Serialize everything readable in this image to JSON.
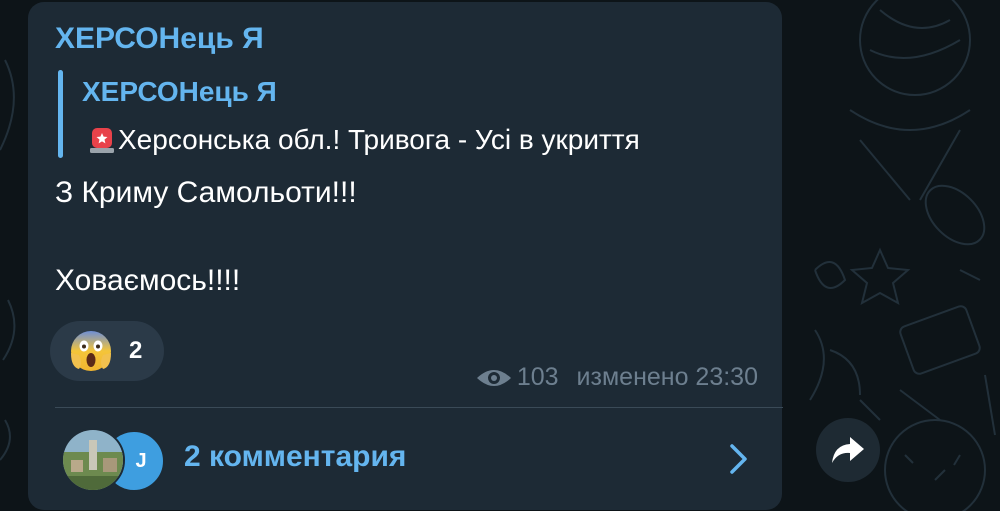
{
  "message": {
    "channel_name": "ХЕРСОНець Я",
    "quote": {
      "author": "ХЕРСОНець Я",
      "text": "Херсонська обл.! Тривога - Усі в укриття"
    },
    "lines": [
      "З Криму Самольоти!!!",
      "Ховаємось!!!!"
    ],
    "reaction": {
      "emoji": "face-screaming-in-fear",
      "count": "2"
    },
    "views": "103",
    "status": "изменено 23:30"
  },
  "comments": {
    "label": "2 комментария",
    "avatar2_initial": "J"
  },
  "colors": {
    "accent": "#64b5ef",
    "bubble": "#1d2a35",
    "meta": "#6d7f8f"
  }
}
